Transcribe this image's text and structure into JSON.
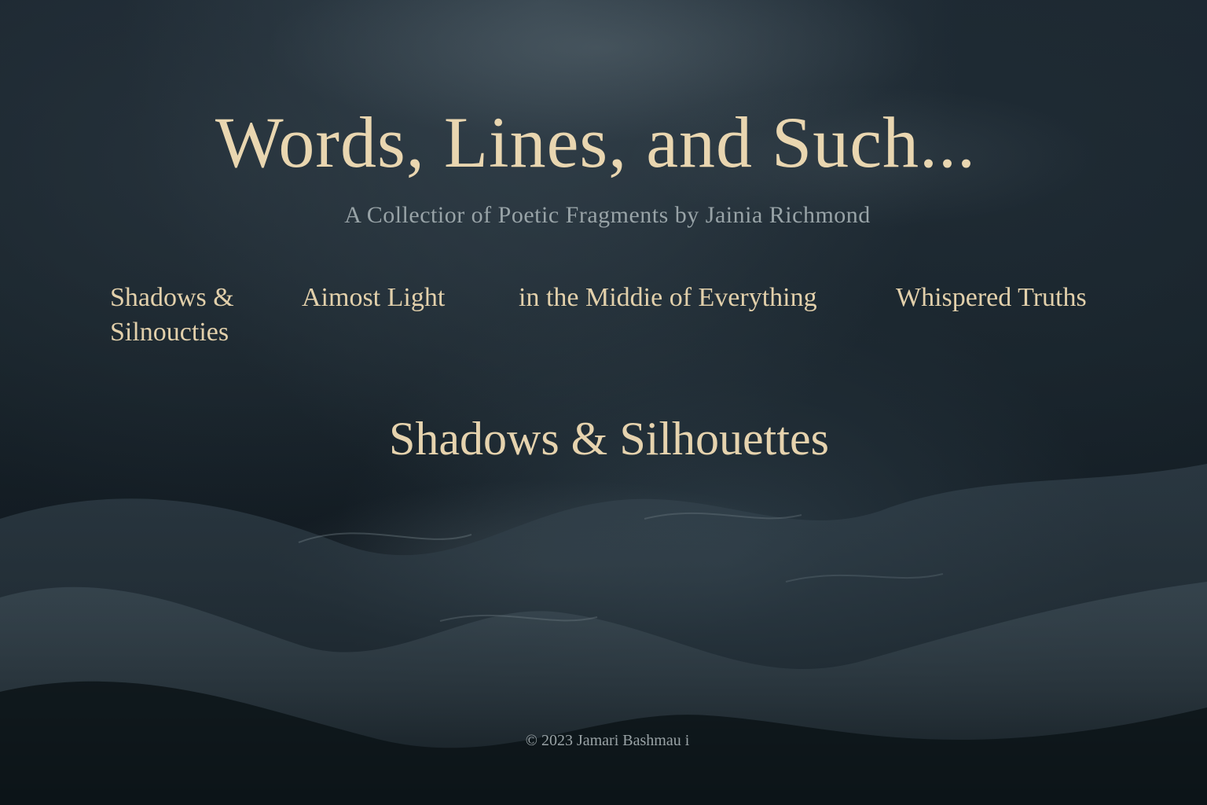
{
  "header": {
    "title": "Words, Lines, and Such...",
    "subtitle": "A Collectior of Poetic Fragments by Jainia Richmond"
  },
  "nav": {
    "items": [
      {
        "label": "Shadows & Silnoucties"
      },
      {
        "label": "Aimost Light"
      },
      {
        "label": "in the Middie of Everything"
      },
      {
        "label": "Whispered Truths"
      }
    ]
  },
  "main": {
    "section_title": "Shadows & Silhouettes"
  },
  "footer": {
    "copyright": "© 2023 Jamari Bashmau i"
  },
  "theme": {
    "background": "#172229",
    "title_color": "#e9d6b0",
    "nav_color": "#e2d0ab",
    "muted_text": "#98a3a7"
  }
}
